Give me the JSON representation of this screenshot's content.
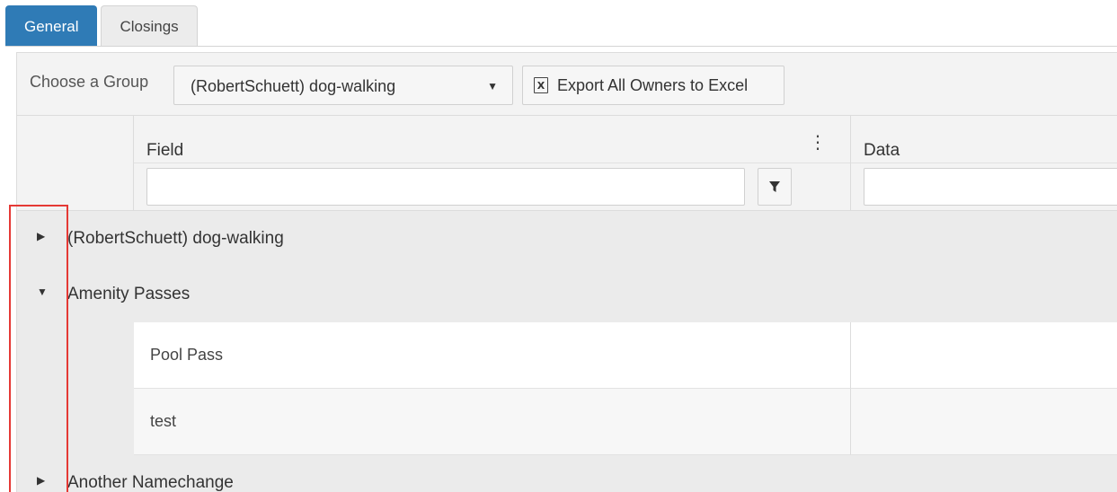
{
  "tabs": [
    {
      "label": "General",
      "active": true
    },
    {
      "label": "Closings",
      "active": false
    }
  ],
  "toolbar": {
    "group_label": "Choose a Group",
    "group_selected": "(RobertSchuett) dog-walking",
    "export_label": "Export All Owners to Excel",
    "export_icon": "excel-icon",
    "dropdown_icon": "caret-down-icon"
  },
  "columns": [
    {
      "title": "Field",
      "filter_value": ""
    },
    {
      "title": "Data",
      "filter_value": ""
    }
  ],
  "groups": [
    {
      "label": "(RobertSchuett) dog-walking",
      "expanded": false
    },
    {
      "label": "Amenity Passes",
      "expanded": true,
      "rows": [
        {
          "field": "Pool Pass",
          "data": ""
        },
        {
          "field": "test",
          "data": ""
        }
      ]
    },
    {
      "label": "Another Namechange",
      "expanded": false
    }
  ],
  "colors": {
    "tab_active": "#2f7bb6",
    "highlight": "#e53935",
    "header_bg": "#f3f3f3",
    "group_bg": "#ebebeb"
  }
}
